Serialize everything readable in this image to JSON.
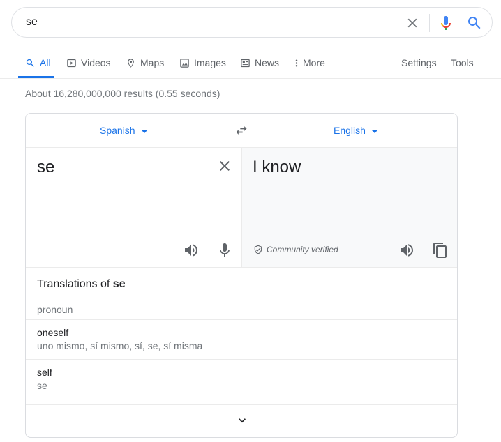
{
  "search": {
    "query": "se",
    "placeholder": ""
  },
  "tabs": [
    {
      "label": "All",
      "icon": "search-icon",
      "active": true
    },
    {
      "label": "Videos",
      "icon": "play-icon"
    },
    {
      "label": "Maps",
      "icon": "map-pin-icon"
    },
    {
      "label": "Images",
      "icon": "image-icon"
    },
    {
      "label": "News",
      "icon": "newspaper-icon"
    },
    {
      "label": "More",
      "icon": "more-vert-icon"
    }
  ],
  "tools": {
    "settings": "Settings",
    "tools": "Tools"
  },
  "result_stats": "About 16,280,000,000 results (0.55 seconds)",
  "translate": {
    "source_lang": "Spanish",
    "target_lang": "English",
    "source_text": "se",
    "target_text": "I know",
    "verified_label": "Community verified",
    "translations_heading_prefix": "Translations of ",
    "translations_heading_term": "se",
    "part_of_speech": "pronoun",
    "entries": [
      {
        "word": "oneself",
        "synonyms": "uno mismo, sí mismo, sí, se, sí misma"
      },
      {
        "word": "self",
        "synonyms": "se"
      }
    ]
  },
  "colors": {
    "link_blue": "#1a73e8",
    "text_primary": "#202124",
    "text_secondary": "#70757a",
    "icon_gray": "#5f6368",
    "border": "#dadce0",
    "target_pane_bg": "#f8f9fa"
  }
}
